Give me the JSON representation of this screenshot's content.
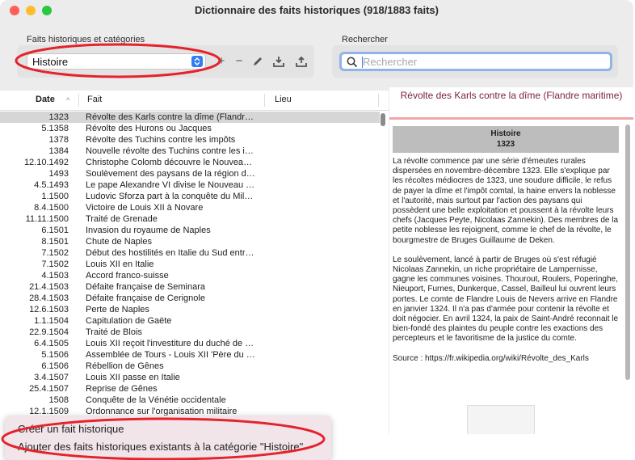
{
  "window": {
    "title": "Dictionnaire des faits historiques (918/1883 faits)"
  },
  "toolbar": {
    "category_label": "Faits historiques et catégories",
    "category_selected": "Histoire",
    "search_label": "Rechercher",
    "search_placeholder": "Rechercher",
    "add_symbol": "+",
    "remove_symbol": "−"
  },
  "table": {
    "columns": {
      "date": "Date",
      "fait": "Fait",
      "lieu": "Lieu"
    },
    "sort_indicator": "^",
    "rows": [
      {
        "date": "1323",
        "fait": "Révolte des Karls contre la dîme (Flandre maritime)",
        "selected": true
      },
      {
        "date": "5.1358",
        "fait": "Révolte des Hurons ou Jacques"
      },
      {
        "date": "1378",
        "fait": "Révolte des Tuchins contre les impôts"
      },
      {
        "date": "1384",
        "fait": "Nouvelle révolte des Tuchins contre les impôts"
      },
      {
        "date": "12.10.1492",
        "fait": "Christophe Colomb découvre le Nouveau Monde"
      },
      {
        "date": "1493",
        "fait": "Soulèvement des paysans de la région de Sélestat"
      },
      {
        "date": "4.5.1493",
        "fait": "Le pape Alexandre VI divise le Nouveau Monde"
      },
      {
        "date": "1.1500",
        "fait": "Ludovic Sforza part à la conquête du Milanais"
      },
      {
        "date": "8.4.1500",
        "fait": "Victoire de Louis XII à Novare"
      },
      {
        "date": "11.11.1500",
        "fait": "Traité de Grenade"
      },
      {
        "date": "6.1501",
        "fait": "Invasion du royaume de Naples"
      },
      {
        "date": "8.1501",
        "fait": "Chute de Naples"
      },
      {
        "date": "7.1502",
        "fait": "Début des hostilités en Italie du Sud entre Français et Espagnols"
      },
      {
        "date": "7.1502",
        "fait": "Louis XII en Italie"
      },
      {
        "date": "4.1503",
        "fait": "Accord franco-suisse"
      },
      {
        "date": "21.4.1503",
        "fait": "Défaite française de Seminara"
      },
      {
        "date": "28.4.1503",
        "fait": "Défaite française de Cerignole"
      },
      {
        "date": "12.6.1503",
        "fait": "Perte de Naples"
      },
      {
        "date": "1.1.1504",
        "fait": "Capitulation de Gaëte"
      },
      {
        "date": "22.9.1504",
        "fait": "Traité de Blois"
      },
      {
        "date": "6.4.1505",
        "fait": "Louis XII reçoit l'investiture du duché de Milan"
      },
      {
        "date": "5.1506",
        "fait": "Assemblée de Tours - Louis XII 'Père du peuple'"
      },
      {
        "date": "6.1506",
        "fait": "Rébellion de Gênes"
      },
      {
        "date": "3.4.1507",
        "fait": "Louis XII passe en Italie"
      },
      {
        "date": "25.4.1507",
        "fait": "Reprise de Gênes"
      },
      {
        "date": "1508",
        "fait": "Conquête de la Vénétie occidentale"
      },
      {
        "date": "12.1.1509",
        "fait": "Ordonnance sur l'organisation militaire"
      }
    ]
  },
  "detail": {
    "title": "Révolte des Karls contre la dîme (Flandre maritime)",
    "category": "Histoire",
    "date": "1323",
    "paragraph1": "La révolte commence par une série d'émeutes rurales dispersées en novembre-décembre 1323. Elle s'explique par les récoltes médiocres de 1323, une soudure difficile, le refus de payer la dîme et l'impôt comtal, la haine envers la noblesse et l'autorité, mais surtout par l'action des paysans qui possèdent une belle exploitation et poussent à la révolte leurs chefs (Jacques Peyte, Nicolaas Zannekin). Des membres de la petite noblesse les rejoignent, comme le chef de la révolte, le bourgmestre de Bruges Guillaume de Deken.",
    "paragraph2": "Le soulèvement, lancé à partir de Bruges où s'est réfugié Nicolaas Zannekin, un riche propriétaire de Lampernisse, gagne les communes voisines. Thourout, Roulers, Poperinghe, Nieuport, Furnes, Dunkerque, Cassel, Bailleul lui ouvrent leurs portes. Le comte de Flandre Louis de Nevers arrive en Flandre en janvier 1324. Il n'a pas d'armée pour contenir la révolte et doit négocier. En avril 1324, la paix de Saint-André reconnait le bien-fondé des plaintes du peuple contre les exactions des percepteurs et le favoritisme de la justice du comte.",
    "source": "Source : https://fr.wikipedia.org/wiki/Révolte_des_Karls"
  },
  "context_menu": {
    "items": [
      "Créer un fait historique",
      "Ajouter des faits historiques existants à la catégorie \"Histoire\""
    ]
  },
  "colors": {
    "accent": "#2f7cf6",
    "annotation_red": "#e4232b",
    "detail_title": "#7a2345",
    "detail_header_bg": "#bdbdbd"
  }
}
